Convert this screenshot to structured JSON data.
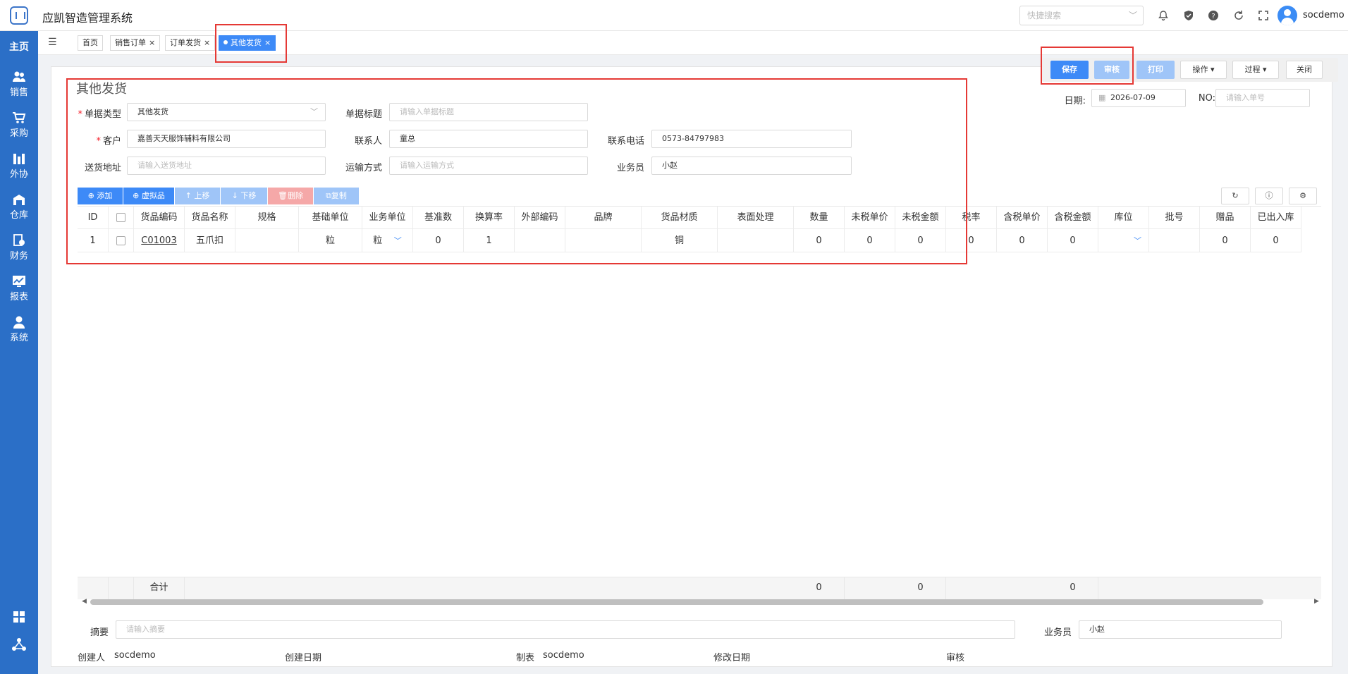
{
  "app": {
    "title": "应凯智造管理系统",
    "username": "socdemo"
  },
  "header": {
    "quick_search_placeholder": "快捷搜索"
  },
  "sidebar": {
    "home": "主页",
    "items": [
      {
        "label": "销售",
        "icon": "people-icon"
      },
      {
        "label": "采购",
        "icon": "cart-icon"
      },
      {
        "label": "外协",
        "icon": "chart-bars-icon"
      },
      {
        "label": "仓库",
        "icon": "warehouse-icon"
      },
      {
        "label": "财务",
        "icon": "finance-icon"
      },
      {
        "label": "报表",
        "icon": "report-icon"
      },
      {
        "label": "系统",
        "icon": "user-icon"
      }
    ]
  },
  "tabs": [
    {
      "label": "首页"
    },
    {
      "label": "销售订单"
    },
    {
      "label": "订单发货"
    },
    {
      "label": "其他发货"
    }
  ],
  "actions": {
    "save": "保存",
    "audit": "审核",
    "print": "打印",
    "operate": "操作",
    "process": "过程",
    "close": "关闭"
  },
  "form": {
    "title": "其他发货",
    "date_label": "日期:",
    "date_value": "2026-07-09",
    "no_label": "NO:",
    "no_placeholder": "请输入单号",
    "doc_type_label": "单据类型",
    "doc_type_value": "其他发货",
    "doc_title_label": "单据标题",
    "doc_title_placeholder": "请输入单据标题",
    "customer_label": "客户",
    "customer_value": "嘉善天天服饰辅料有限公司",
    "contact_label": "联系人",
    "contact_value": "童总",
    "phone_label": "联系电话",
    "phone_value": "0573-84797983",
    "address_label": "送货地址",
    "address_placeholder": "请输入送货地址",
    "transport_label": "运输方式",
    "transport_placeholder": "请输入运输方式",
    "salesman_label": "业务员",
    "salesman_value": "小赵"
  },
  "grid_toolbar": {
    "add": "⊕ 添加",
    "virtual": "⊕ 虚拟品",
    "up": "↑ 上移",
    "down": "↓ 下移",
    "delete": "删除",
    "copy": "复制"
  },
  "grid": {
    "columns": [
      "ID",
      "",
      "货品编码",
      "货品名称",
      "规格",
      "基础单位",
      "业务单位",
      "基准数",
      "换算率",
      "外部编码",
      "品牌",
      "货品材质",
      "表面处理",
      "数量",
      "未税单价",
      "未税金额",
      "税率",
      "含税单价",
      "含税金额",
      "库位",
      "批号",
      "赠品",
      "已出入库"
    ],
    "rows": [
      [
        "1",
        "",
        "C01003",
        "五爪扣",
        "",
        "粒",
        "粒",
        "0",
        "1",
        "",
        "",
        "铜",
        "",
        "0",
        "0",
        "0",
        "0",
        "0",
        "0",
        "",
        "",
        "0",
        "0"
      ]
    ],
    "footer_label": "合计",
    "footer_qty": "0",
    "footer_untaxed": "0",
    "footer_taxed": "0"
  },
  "bottom": {
    "summary_label": "摘要",
    "summary_placeholder": "请输入摘要",
    "salesman_label": "业务员",
    "salesman_value": "小赵",
    "creator_label": "创建人",
    "creator_value": "socdemo",
    "created_label": "创建日期",
    "maker_label": "制表",
    "maker_value": "socdemo",
    "modified_label": "修改日期",
    "audit_label": "审核"
  }
}
